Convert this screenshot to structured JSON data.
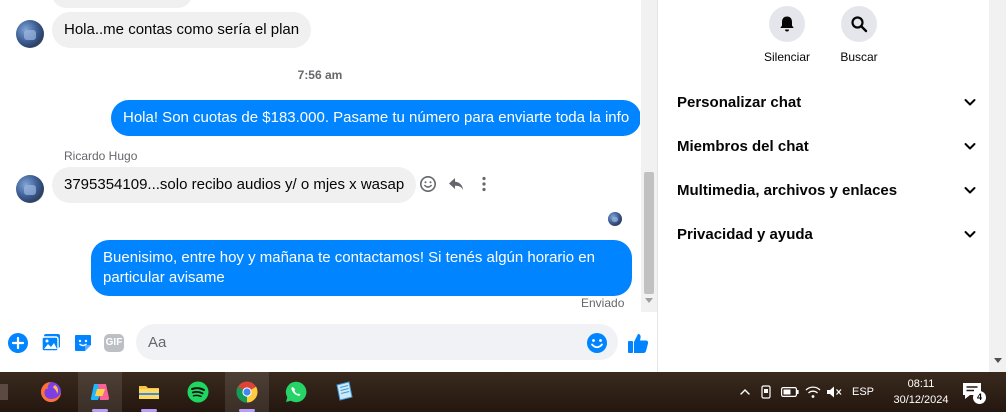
{
  "chat": {
    "messages": [
      {
        "id": "m1",
        "text": "Hola..me contas como sería el plan"
      },
      {
        "id": "m2",
        "text": "Hola! Son cuotas de $183.000. Pasame tu número para enviarte toda la info"
      },
      {
        "id": "m3",
        "sender": "Ricardo Hugo",
        "text": "3795354109...solo recibo audios y/ o mjes x wasap"
      },
      {
        "id": "m4",
        "text": "Buenisimo, entre hoy y mañana te contactamos! Si tenés algún horario en particular avisame"
      }
    ],
    "timestamp": "7:56 am",
    "status": "Enviado"
  },
  "composer": {
    "placeholder": "Aa",
    "value": "",
    "icons": [
      "plus-icon",
      "photo-icon",
      "sticker-icon",
      "gif-icon",
      "emoji-icon",
      "like-icon"
    ],
    "gif_label": "GIF"
  },
  "info": {
    "actions": [
      {
        "label": "Silenciar",
        "icon": "bell-icon"
      },
      {
        "label": "Buscar",
        "icon": "search-icon"
      }
    ],
    "sections": [
      {
        "label": "Personalizar chat"
      },
      {
        "label": "Miembros del chat"
      },
      {
        "label": "Multimedia, archivos y enlaces"
      },
      {
        "label": "Privacidad y ayuda"
      }
    ]
  },
  "taskbar": {
    "apps": [
      "firefox-icon",
      "copilot-icon",
      "file-explorer-icon",
      "spotify-icon",
      "chrome-icon",
      "whatsapp-icon",
      "notepad-icon"
    ],
    "language": "ESP",
    "time": "08:11",
    "date": "30/12/2024",
    "notification_count": "4"
  },
  "colors": {
    "accent": "#0084ff",
    "bubble_in": "#f0f0f0",
    "taskbar": "#2b1e14"
  }
}
